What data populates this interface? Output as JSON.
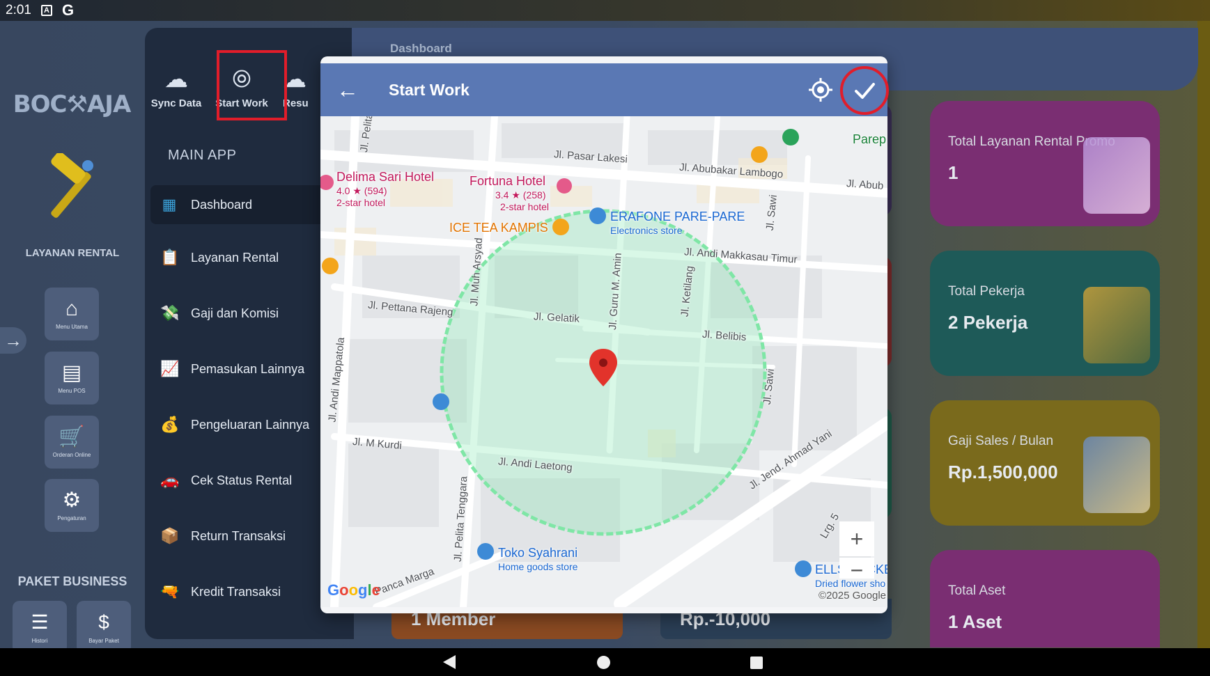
{
  "status_bar": {
    "time": "2:01",
    "icons": [
      "a-icon",
      "google-icon"
    ],
    "google_glyph": "G",
    "a_glyph": "A"
  },
  "rail": {
    "logo_text": "BOC⚒AJA",
    "title": "LAYANAN RENTAL",
    "buttons": [
      {
        "icon": "home-icon",
        "glyph": "⌂",
        "label": "Menu Utama"
      },
      {
        "icon": "pos-store-icon",
        "glyph": "▤",
        "label": "Menu POS"
      },
      {
        "icon": "cart-icon",
        "glyph": "🛒",
        "label": "Orderan Online"
      },
      {
        "icon": "gear-icon",
        "glyph": "⚙",
        "label": "Pengaturan"
      }
    ],
    "paket_title": "PAKET BUSINESS",
    "paket_buttons": [
      {
        "icon": "history-icon",
        "glyph": "☰",
        "label": "Histori"
      },
      {
        "icon": "dollar-icon",
        "glyph": "$",
        "label": "Bayar Paket"
      }
    ]
  },
  "side_menu": {
    "top_actions": [
      {
        "icon": "cloud-sync-icon",
        "glyph": "☁",
        "label": "Sync Data"
      },
      {
        "icon": "fingerprint-icon",
        "glyph": "⦾",
        "label": "Start Work"
      },
      {
        "icon": "cloud-upload-icon",
        "glyph": "☁",
        "label": "Resu"
      }
    ],
    "section_label": "MAIN APP",
    "items": [
      {
        "icon": "dashboard-icon",
        "glyph": "▦",
        "label": "Dashboard",
        "active": true
      },
      {
        "icon": "rental-list-icon",
        "glyph": "📋",
        "label": "Layanan Rental"
      },
      {
        "icon": "salary-icon",
        "glyph": "💸",
        "label": "Gaji dan Komisi"
      },
      {
        "icon": "income-icon",
        "glyph": "📈",
        "label": "Pemasukan Lainnya"
      },
      {
        "icon": "expense-icon",
        "glyph": "💰",
        "label": "Pengeluaran Lainnya"
      },
      {
        "icon": "status-rental-icon",
        "glyph": "🚗",
        "label": "Cek Status Rental"
      },
      {
        "icon": "return-icon",
        "glyph": "📦",
        "label": "Return Transaksi"
      },
      {
        "icon": "credit-icon",
        "glyph": "🔫",
        "label": "Kredit Transaksi"
      }
    ]
  },
  "dashboard": {
    "title": "Dashboard",
    "cards": [
      {
        "title": "Total Layanan Rental Promo",
        "value": "1",
        "color": "#7a2e72"
      },
      {
        "title": "Total Pekerja",
        "value": "2 Pekerja",
        "color": "#1e5a58"
      },
      {
        "title": "Gaji Sales / Bulan",
        "value": "Rp.1,500,000",
        "color": "#7a6a1c"
      },
      {
        "title": "Total Aset",
        "value": "1 Aset",
        "color": "#7a2e72"
      }
    ],
    "mid_cards": [
      {
        "value": "1 Member",
        "color": "#8a4a22"
      },
      {
        "value": "Rp.-10,000",
        "color": "#2a3e55"
      }
    ]
  },
  "modal": {
    "title": "Start Work",
    "back_icon": "arrow-left-icon",
    "locate_icon": "crosshair-icon",
    "confirm_icon": "check-icon",
    "map": {
      "streets": [
        "Jl. Pasar Lakesi",
        "Jl. Abubakar Lambogo",
        "Jl. Abub",
        "Jl. Pelita",
        "Jl. Andi Makkasau Timur",
        "Jl. Pettana Rajeng",
        "Jl. Gelatik",
        "Jl. Muh Arsyad",
        "Jl. Guru M. Amin",
        "Jl. Ketilang",
        "Jl. Belibis",
        "Jl. Sawi",
        "Jl. Andi Mappatola",
        "Jl. M Kurdi",
        "Jl. Andi Laetong",
        "Jl. Jend. Ahmad Yani",
        "Jl. Pelita Tenggara",
        "Jl. Sawi",
        "Lrg. 5",
        "Panca Marga"
      ],
      "pois": [
        {
          "name": "Delima Sari Hotel",
          "rating": "4.0 ★ (594)",
          "type": "2-star hotel",
          "color": "#d6336c"
        },
        {
          "name": "Fortuna Hotel",
          "rating": "3.4 ★ (258)",
          "type": "2-star hotel",
          "color": "#d6336c"
        },
        {
          "name": "ERAFONE PARE-PARE",
          "sub": "Electronics store",
          "color": "#2f78c4"
        },
        {
          "name": "ICE TEA KAMPIS",
          "color": "#e08a0b"
        },
        {
          "name": "Parep",
          "color": "#188038"
        },
        {
          "name": "Toko Syahrani",
          "sub": "Home goods store",
          "color": "#2f78c4"
        },
        {
          "name": "ELLS BUCKE",
          "sub": "Dried flower sho",
          "color": "#2f78c4"
        }
      ],
      "zoom_in": "+",
      "zoom_out": "−",
      "logo": "Google",
      "copyright": "©2025 Google"
    }
  }
}
